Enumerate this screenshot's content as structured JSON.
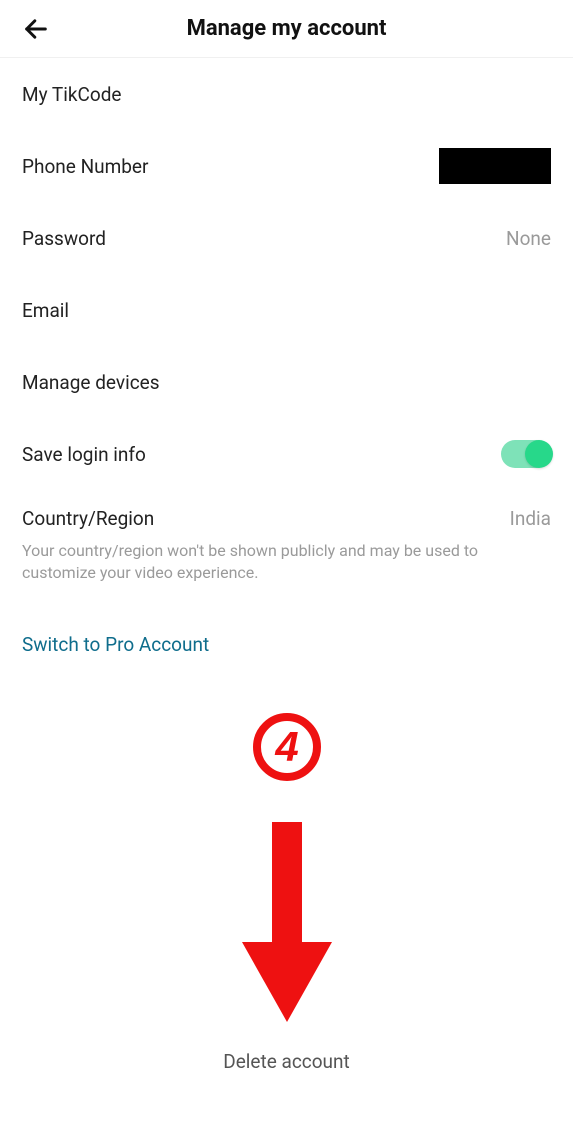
{
  "header": {
    "title": "Manage my account"
  },
  "rows": {
    "tikcode": {
      "label": "My TikCode"
    },
    "phone": {
      "label": "Phone Number"
    },
    "password": {
      "label": "Password",
      "value": "None"
    },
    "email": {
      "label": "Email"
    },
    "devices": {
      "label": "Manage devices"
    },
    "savelogin": {
      "label": "Save login info"
    },
    "country": {
      "label": "Country/Region",
      "value": "India",
      "helper": "Your country/region won't be shown publicly and may be used to customize your video experience."
    }
  },
  "pro_link": "Switch to Pro Account",
  "delete_account": "Delete account",
  "annotation": {
    "step_number": "4"
  }
}
